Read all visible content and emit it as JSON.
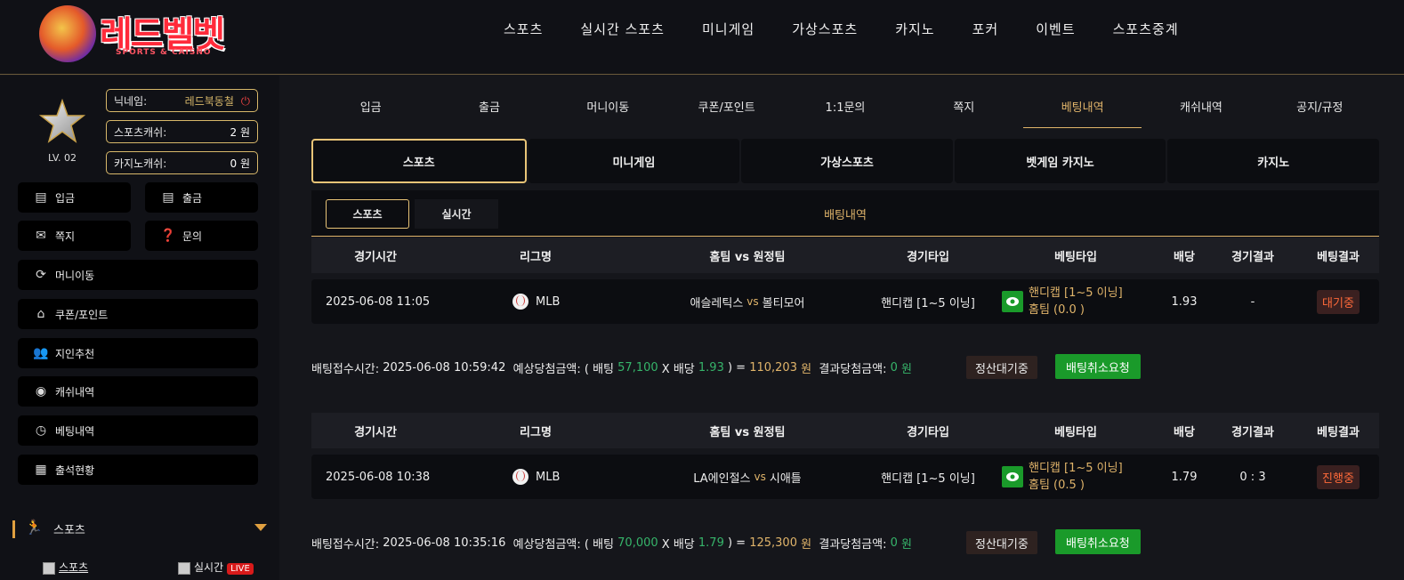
{
  "header": {
    "logo_text": "레드벨벳",
    "logo_sub": "SPORTS & CAISNO",
    "nav": [
      "스포츠",
      "실시간 스포츠",
      "미니게임",
      "가상스포츠",
      "카지노",
      "포커",
      "이벤트",
      "스포츠중계"
    ]
  },
  "sidebar": {
    "level": "LV. 02",
    "nickname_label": "닉네임:",
    "nickname_value": "레드북동철",
    "sports_cash_label": "스포츠캐쉬:",
    "sports_cash_value": "2 원",
    "casino_cash_label": "카지노캐쉬:",
    "casino_cash_value": "0 원",
    "buttons": {
      "deposit": "입금",
      "withdraw": "출금",
      "message": "쪽지",
      "inquiry": "문의",
      "money_move": "머니이동",
      "coupon": "쿠폰/포인트",
      "referral": "지인추천",
      "cash_history": "캐쉬내역",
      "bet_history": "베팅내역",
      "attendance": "출석현황"
    },
    "sports_section": "스포츠",
    "sub_sports": "스포츠",
    "sub_live": "실시간",
    "live_badge": "LIVE"
  },
  "tabs1": [
    "입금",
    "출금",
    "머니이동",
    "쿠폰/포인트",
    "1:1문의",
    "쪽지",
    "베팅내역",
    "캐쉬내역",
    "공지/규정"
  ],
  "tabs1_active": 6,
  "tabs2": [
    "스포츠",
    "미니게임",
    "가상스포츠",
    "벳게임 카지노",
    "카지노"
  ],
  "subbar": {
    "sports": "스포츠",
    "live": "실시간",
    "title": "배팅내역"
  },
  "table_headers": [
    "경기시간",
    "리그명",
    "홈팀 vs 원정팀",
    "경기타입",
    "베팅타입",
    "배당",
    "경기결과",
    "베팅결과"
  ],
  "vs_label": "vs",
  "bets": [
    {
      "time": "2025-06-08 11:05",
      "league": "MLB",
      "home": "애슬레틱스",
      "away": "볼티모어",
      "game_type": "핸디캡 [1~5 이닝]",
      "bet_type_line1": "핸디캡 [1~5 이닝]",
      "bet_type_line2": "홈팀 (0.0 )",
      "odds": "1.93",
      "result": "-",
      "status": "대기중",
      "summary": {
        "accepted_label": "배팅접수시간: ",
        "accepted_time": "2025-06-08 10:59:42",
        "expected_label": "  예상당첨금액: ( 배팅 ",
        "stake": "57,100",
        "x_label": " X 배당 ",
        "odds": "1.93",
        "eq_label": " ) = ",
        "expected": "110,203",
        "won_label": " 원  ",
        "result_label": "결과당첨금액: ",
        "result_amount": "0",
        "won2_label": " 원",
        "wait_btn": "정산대기중",
        "cancel_btn": "배팅취소요청"
      }
    },
    {
      "time": "2025-06-08 10:38",
      "league": "MLB",
      "home": "LA에인절스",
      "away": "시애틀",
      "game_type": "핸디캡 [1~5 이닝]",
      "bet_type_line1": "핸디캡 [1~5 이닝]",
      "bet_type_line2": "홈팀 (0.5 )",
      "odds": "1.79",
      "result": "0 : 3",
      "status": "진행중",
      "summary": {
        "accepted_label": "배팅접수시간: ",
        "accepted_time": "2025-06-08 10:35:16",
        "expected_label": "  예상당첨금액: ( 배팅 ",
        "stake": "70,000",
        "x_label": " X 배당 ",
        "odds": "1.79",
        "eq_label": " ) = ",
        "expected": "125,300",
        "won_label": " 원  ",
        "result_label": "결과당첨금액: ",
        "result_amount": "0",
        "won2_label": " 원",
        "wait_btn": "정산대기중",
        "cancel_btn": "배팅취소요청"
      }
    }
  ],
  "colors": {
    "gold": "#e0b46a",
    "green": "#1a9a2a",
    "status_red": "#ff6a3a",
    "live_red": "#d81a1a"
  }
}
